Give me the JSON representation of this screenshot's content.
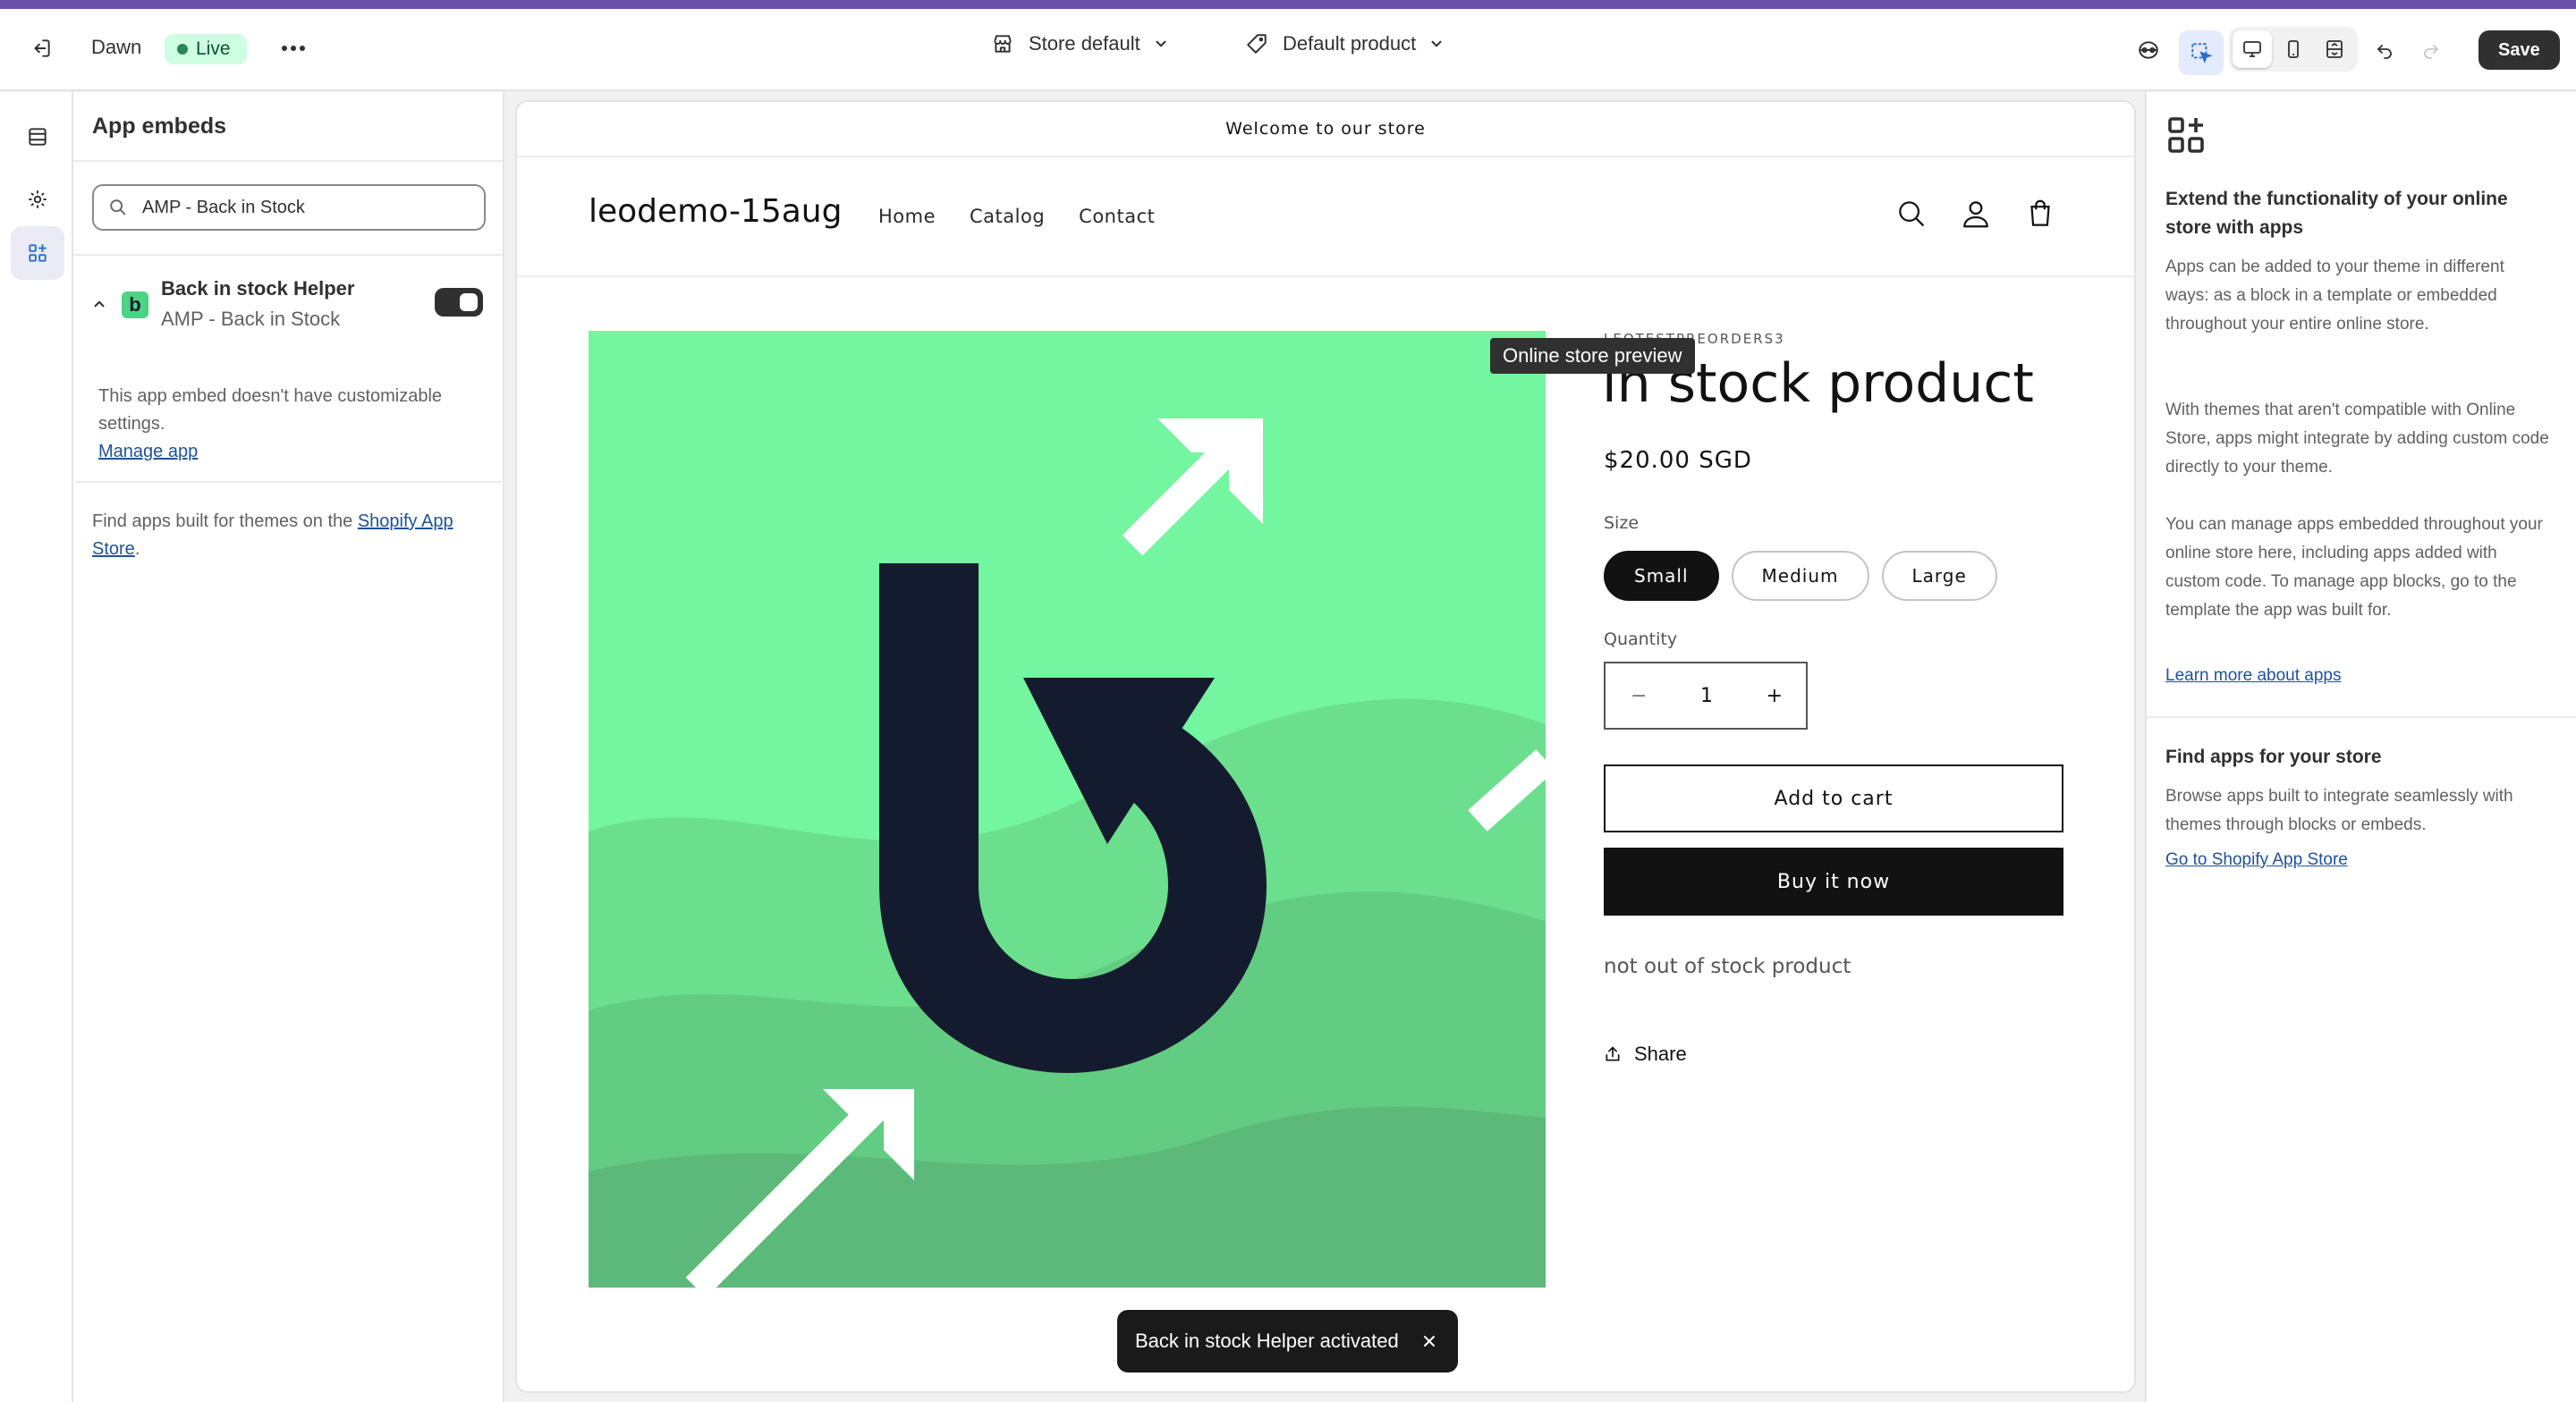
{
  "topbar": {
    "theme_name": "Dawn",
    "live_label": "Live",
    "template_selector": "Store default",
    "product_selector": "Default product",
    "save_label": "Save"
  },
  "panel": {
    "title": "App embeds",
    "search_value": "AMP - Back in Stock",
    "app": {
      "name": "Back in stock Helper",
      "subtitle": "AMP - Back in Stock",
      "logo_letter": "b",
      "enabled": true
    },
    "no_settings_note": "This app embed doesn't have customizable settings.",
    "manage_link": "Manage app",
    "find_apps_prefix": "Find apps built for themes on the ",
    "find_apps_link": "Shopify App Store",
    "find_apps_suffix": "."
  },
  "preview": {
    "announcement": "Welcome to our store",
    "store_name": "leodemo-15aug",
    "nav": [
      "Home",
      "Catalog",
      "Contact"
    ],
    "vendor": "LEOTESTPREORDERS3",
    "product_title": "in stock product",
    "price": "$20.00 SGD",
    "size_label": "Size",
    "sizes": [
      "Small",
      "Medium",
      "Large"
    ],
    "selected_size": "Small",
    "quantity_label": "Quantity",
    "quantity": "1",
    "minus": "−",
    "plus": "+",
    "add_to_cart": "Add to cart",
    "buy_now": "Buy it now",
    "description": "not out of stock product",
    "share": "Share"
  },
  "tooltip": "Online store preview",
  "toast": {
    "message": "Back in stock Helper activated"
  },
  "right_panel": {
    "heading": "Extend the functionality of your online store with apps",
    "p1": "Apps can be added to your theme in different ways: as a block in a template or embedded throughout your entire online store.",
    "p2": "With themes that aren't compatible with Online Store, apps might integrate by adding custom code directly to your theme.",
    "p3": "You can manage apps embedded throughout your online store here, including apps added with custom code. To manage app blocks, go to the template the app was built for.",
    "learn_link": "Learn more about apps",
    "find_heading": "Find apps for your store",
    "find_p": "Browse apps built to integrate seamlessly with themes through blocks or embeds.",
    "store_link": "Go to Shopify App Store"
  },
  "colors": {
    "accent_stripe": "#6b4fa8",
    "live_bg": "#cdfee1",
    "live_text": "#0c5132",
    "product_bg": "#74f59f",
    "logo_dark": "#151b2e"
  }
}
